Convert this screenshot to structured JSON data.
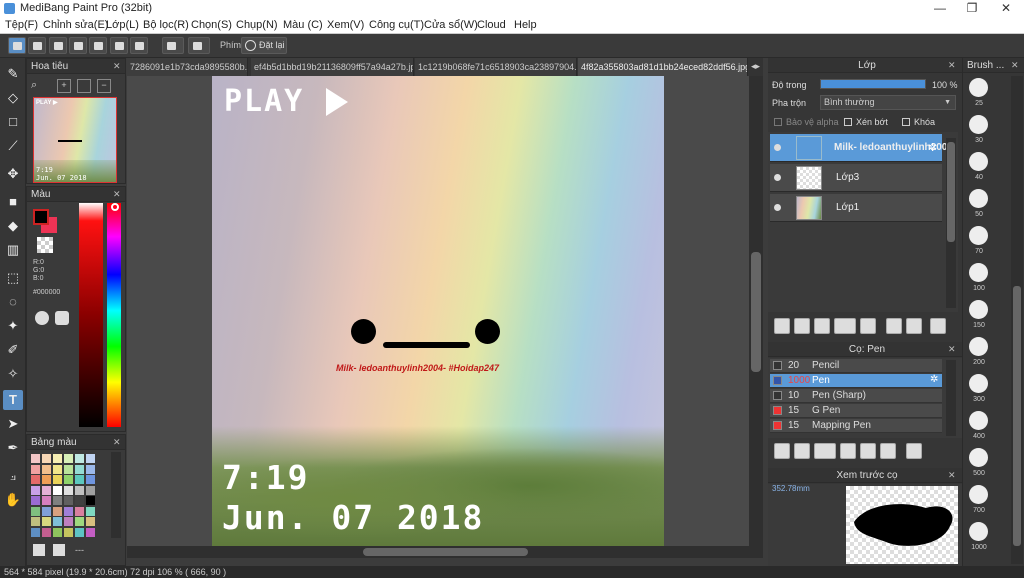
{
  "window": {
    "title": "MediBang Paint Pro (32bit)",
    "minimize": "—",
    "maximize": "❐",
    "close": "✕"
  },
  "menu": [
    "Tệp(F)",
    "Chỉnh sửa(E)",
    "Lớp(L)",
    "Bộ lọc(R)",
    "Chọn(S)",
    "Chụp(N)",
    "Màu (C)",
    "Xem(V)",
    "Công cụ(T)",
    "Cửa sổ(W)",
    "Cloud",
    "Help"
  ],
  "toolbar": {
    "shortcut_label": "Phím",
    "reset_label": "Đặt lại"
  },
  "navigator": {
    "title": "Hoa tiêu",
    "thumb_play": "PLAY ▶",
    "thumb_time": "7:19",
    "thumb_date": "Jun. 07 2018"
  },
  "color": {
    "title": "Màu",
    "r": "R:0",
    "g": "G:0",
    "b": "B:0",
    "hex": "#000000",
    "foreground": "#000000",
    "background": "#ee3355"
  },
  "palette": {
    "title": "Bảng màu",
    "more": "---"
  },
  "tabs": [
    "7286091e1b73cda9895580b.jpg",
    "ef4b5d1bbd19b21136809ff57a94a27b.jpg",
    "1c1219b068fe71c6518903ca23897904.jpg",
    "4f82a355803ad81d1bb24eced82ddf56.jpg"
  ],
  "canvas": {
    "play": "PLAY",
    "time": "7:19",
    "date": "Jun. 07 2018",
    "watermark": "Milk- ledoanthuylinh2004- #Hoidap247"
  },
  "layers": {
    "title": "Lớp",
    "opacity_label": "Độ trong",
    "opacity_value": "100 %",
    "opacity_fraction": 1.0,
    "blend_label": "Pha trộn",
    "blend_value": "Bình thường",
    "protect_alpha": "Bảo vệ alpha",
    "clipping": "Xén bớt",
    "lock": "Khóa",
    "items": [
      {
        "name": "Milk- ledoanthuylinh2004"
      },
      {
        "name": "Lớp3"
      },
      {
        "name": "Lớp1"
      }
    ]
  },
  "brush_list": {
    "title": "Cọ: Pen",
    "items": [
      {
        "size": "20",
        "name": "Pencil",
        "color": "#333333"
      },
      {
        "size": "1000",
        "name": "Pen",
        "color": "#3355aa"
      },
      {
        "size": "10",
        "name": "Pen (Sharp)",
        "color": "#333333"
      },
      {
        "size": "15",
        "name": "G Pen",
        "color": "#ee3333"
      },
      {
        "size": "15",
        "name": "Mapping Pen",
        "color": "#ee3333"
      }
    ]
  },
  "brush_preview": {
    "title": "Xem trước cọ",
    "size": "352.78mm"
  },
  "brush_sizes": {
    "title": "Brush ...",
    "sizes": [
      "25",
      "30",
      "40",
      "50",
      "70",
      "100",
      "150",
      "200",
      "300",
      "400",
      "500",
      "700",
      "1000"
    ]
  },
  "status": {
    "text": "564 * 584 pixel   (19.9 * 20.6cm)   72 dpi   106 %   ( 666, 90 )"
  }
}
